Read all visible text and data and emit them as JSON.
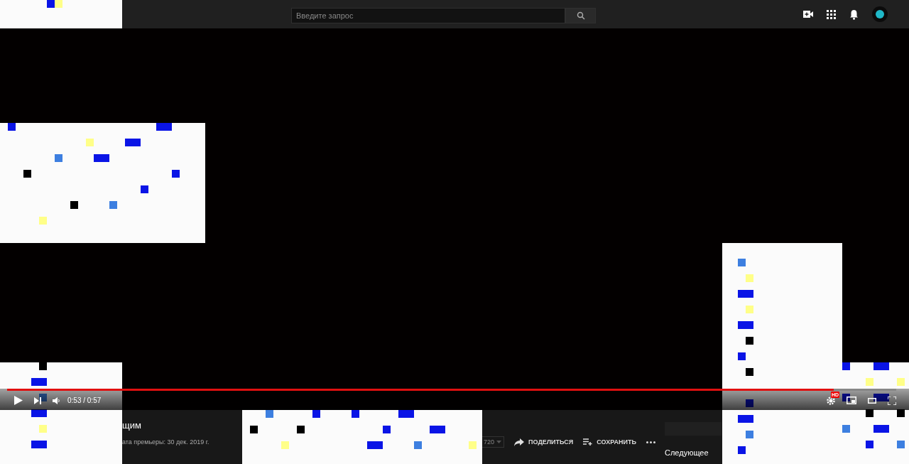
{
  "header": {
    "search": {
      "placeholder": "Введите запрос"
    }
  },
  "player": {
    "progress": {
      "level": 0.93
    },
    "time": "0:53 / 0:57",
    "hd_badge": "HD"
  },
  "video_info": {
    "title": "щим",
    "premiere_date": "ата премьеры: 30 дек. 2019 г.",
    "quality": "720",
    "actions": [
      {
        "kind": "share",
        "label": "ПОДЕЛИТЬСЯ"
      },
      {
        "kind": "save",
        "label": "СОХРАНИТЬ"
      },
      {
        "kind": "more"
      }
    ]
  },
  "sidebar": {
    "heading": "Следующее"
  }
}
